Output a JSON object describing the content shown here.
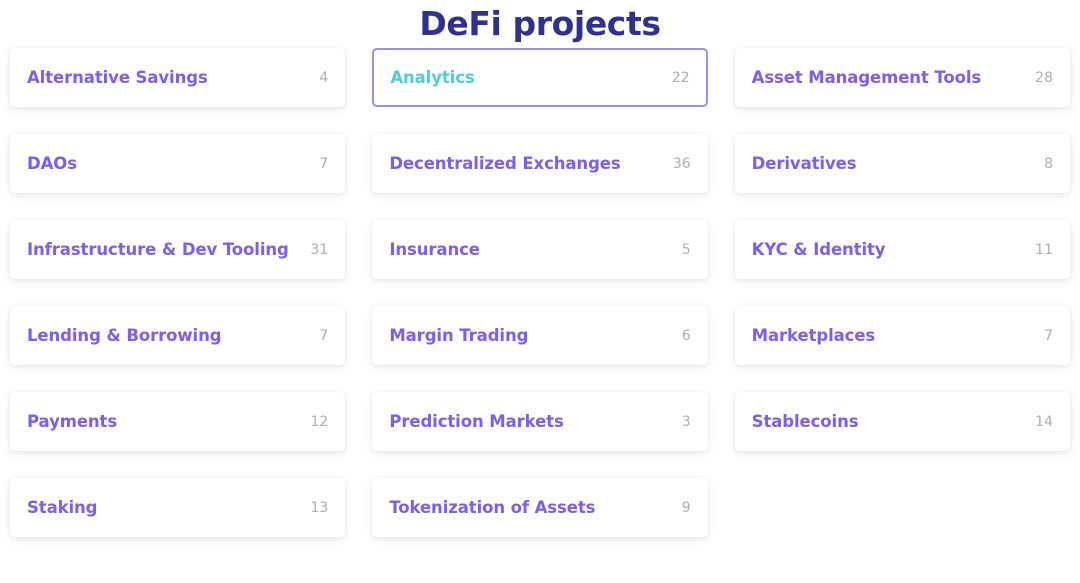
{
  "header": {
    "title": "DeFi projects",
    "title_color": "#2e3192"
  },
  "theme": {
    "label_color": "#7e5cf5",
    "active_label_color": "#4ecddb",
    "active_border_color": "#a08cf5",
    "count_color": "#afafaf",
    "card_background": "#ffffff",
    "page_background": "#ffffff"
  },
  "categories": [
    {
      "label": "Alternative Savings",
      "count": "4",
      "active": false
    },
    {
      "label": "Analytics",
      "count": "22",
      "active": true
    },
    {
      "label": "Asset Management Tools",
      "count": "28",
      "active": false
    },
    {
      "label": "DAOs",
      "count": "7",
      "active": false
    },
    {
      "label": "Decentralized Exchanges",
      "count": "36",
      "active": false
    },
    {
      "label": "Derivatives",
      "count": "8",
      "active": false
    },
    {
      "label": "Infrastructure & Dev Tooling",
      "count": "31",
      "active": false
    },
    {
      "label": "Insurance",
      "count": "5",
      "active": false
    },
    {
      "label": "KYC & Identity",
      "count": "11",
      "active": false
    },
    {
      "label": "Lending & Borrowing",
      "count": "7",
      "active": false
    },
    {
      "label": "Margin Trading",
      "count": "6",
      "active": false
    },
    {
      "label": "Marketplaces",
      "count": "7",
      "active": false
    },
    {
      "label": "Payments",
      "count": "12",
      "active": false
    },
    {
      "label": "Prediction Markets",
      "count": "3",
      "active": false
    },
    {
      "label": "Stablecoins",
      "count": "14",
      "active": false
    },
    {
      "label": "Staking",
      "count": "13",
      "active": false
    },
    {
      "label": "Tokenization of Assets",
      "count": "9",
      "active": false
    }
  ]
}
